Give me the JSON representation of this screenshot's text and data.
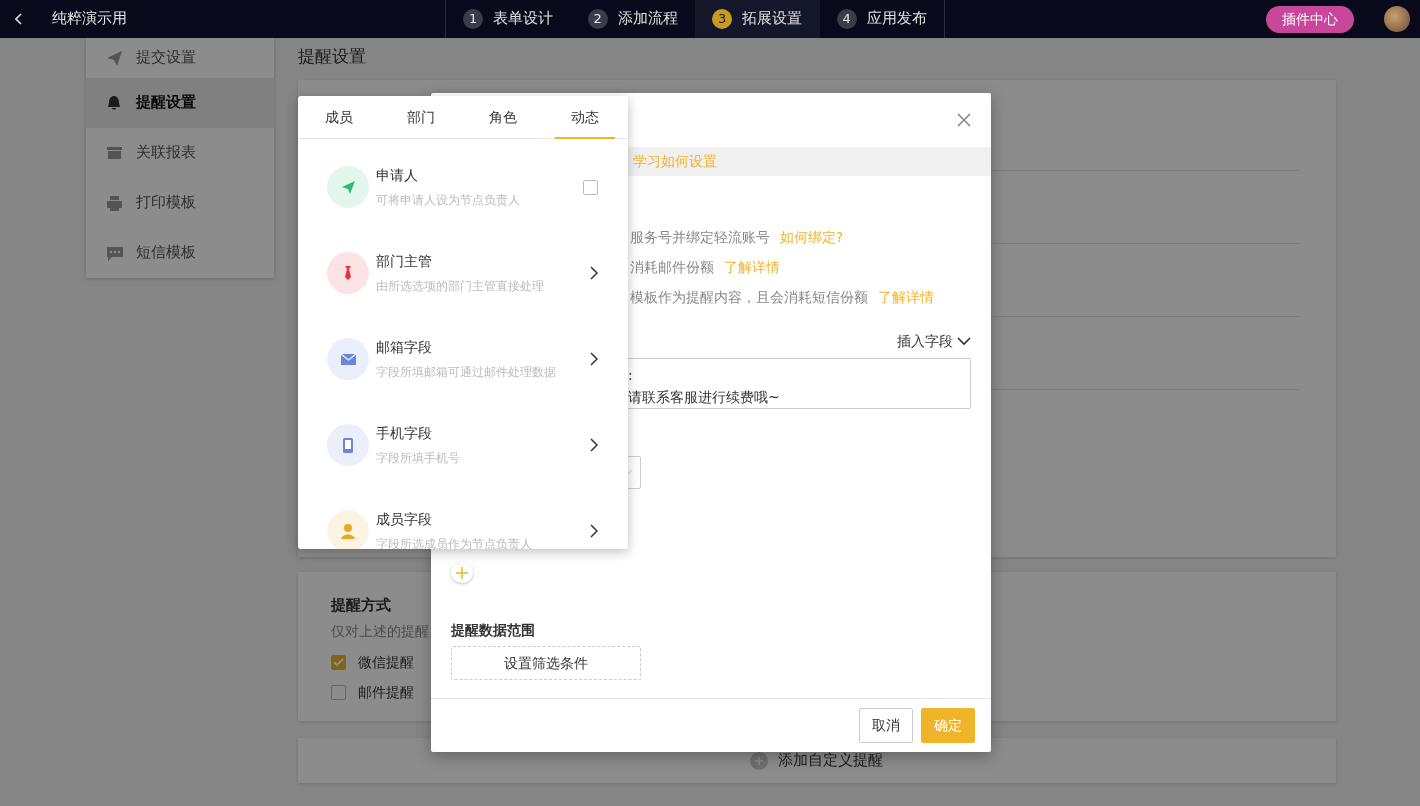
{
  "top_bar": {
    "title": "纯粹演示用",
    "steps": [
      {
        "number": "1",
        "label": "表单设计",
        "selected": false
      },
      {
        "number": "2",
        "label": "添加流程",
        "selected": false
      },
      {
        "number": "3",
        "label": "拓展设置",
        "selected": true
      },
      {
        "number": "4",
        "label": "应用发布",
        "selected": false
      }
    ],
    "plugin_button": "插件中心"
  },
  "sidebar": {
    "items": [
      {
        "label": "提交设置",
        "selected": false
      },
      {
        "label": "提醒设置",
        "selected": true
      },
      {
        "label": "关联报表",
        "selected": false
      },
      {
        "label": "打印模板",
        "selected": false
      },
      {
        "label": "短信模板",
        "selected": false
      }
    ]
  },
  "page_title": "提醒设置",
  "reminder_method": {
    "title": "提醒方式",
    "description": "仅对上述的提醒",
    "options": [
      {
        "label": "微信提醒",
        "checked": true
      },
      {
        "label": "邮件提醒",
        "checked": false
      }
    ]
  },
  "add_custom_reminder": "添加自定义提醒",
  "dialog": {
    "banner_link": "学习如何设置",
    "notes": [
      {
        "text": "服务号并绑定轻流账号",
        "link": "如何绑定?"
      },
      {
        "text": "消耗邮件份额",
        "link": "了解详情"
      },
      {
        "text": "模板作为提醒内容，且会消耗短信份额",
        "link": "了解详情"
      }
    ],
    "insert_field": "插入字段",
    "message_lines": [
      ":",
      "请联系客服进行续费哦~"
    ],
    "data_scope_label": "提醒数据范围",
    "filter_button": "设置筛选条件",
    "buttons": [
      {
        "label": "取消",
        "kind": "secondary"
      },
      {
        "label": "确定",
        "kind": "primary"
      }
    ]
  },
  "picker": {
    "tabs": [
      {
        "label": "成员",
        "selected": false
      },
      {
        "label": "部门",
        "selected": false
      },
      {
        "label": "角色",
        "selected": false
      },
      {
        "label": "动态",
        "selected": true
      }
    ],
    "items": [
      {
        "title": "申请人",
        "subtitle": "可将申请人设为节点负责人",
        "kind": "checkbox",
        "checked": false,
        "color": "#2fb872"
      },
      {
        "title": "部门主管",
        "subtitle": "由所选选项的部门主管直接处理",
        "kind": "submenu",
        "color": "#e8323c"
      },
      {
        "title": "邮箱字段",
        "subtitle": "字段所填邮箱可通过邮件处理数据",
        "kind": "submenu",
        "color": "#6b85e0"
      },
      {
        "title": "手机字段",
        "subtitle": "字段所填手机号",
        "kind": "submenu",
        "color": "#6b85e0"
      },
      {
        "title": "成员字段",
        "subtitle": "字段所选成员作为节点负责人",
        "kind": "submenu",
        "color": "#e8a82a"
      }
    ]
  }
}
